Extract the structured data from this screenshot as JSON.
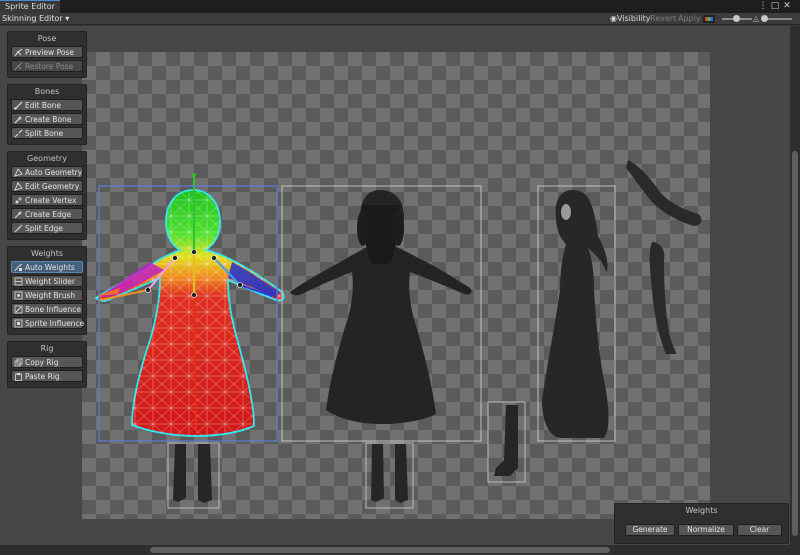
{
  "window": {
    "tab_title": "Sprite Editor",
    "controls": [
      "⋮",
      "□",
      "✕"
    ]
  },
  "toolbar": {
    "mode": "Skinning Editor ▾",
    "visibility": "Visibility",
    "revert": "Revert",
    "apply": "Apply"
  },
  "panels": {
    "pose": {
      "title": "Pose",
      "buttons": [
        "Preview Pose",
        "Restore Pose"
      ]
    },
    "bones": {
      "title": "Bones",
      "buttons": [
        "Edit Bone",
        "Create Bone",
        "Split Bone"
      ]
    },
    "geometry": {
      "title": "Geometry",
      "buttons": [
        "Auto Geometry",
        "Edit Geometry",
        "Create Vertex",
        "Create Edge",
        "Split Edge"
      ]
    },
    "weights": {
      "title": "Weights",
      "buttons": [
        "Auto Weights",
        "Weight Slider",
        "Weight Brush",
        "Bone Influence",
        "Sprite Influence"
      ]
    },
    "rig": {
      "title": "Rig",
      "buttons": [
        "Copy Rig",
        "Paste Rig"
      ]
    }
  },
  "weights_panel": {
    "title": "Weights",
    "generate": "Generate",
    "normalize": "Normalize",
    "clear": "Clear"
  },
  "colors": {
    "selection": "#5a7fd6",
    "accent": "#4d88d8",
    "mesh_outline": "#2fe6f0"
  }
}
